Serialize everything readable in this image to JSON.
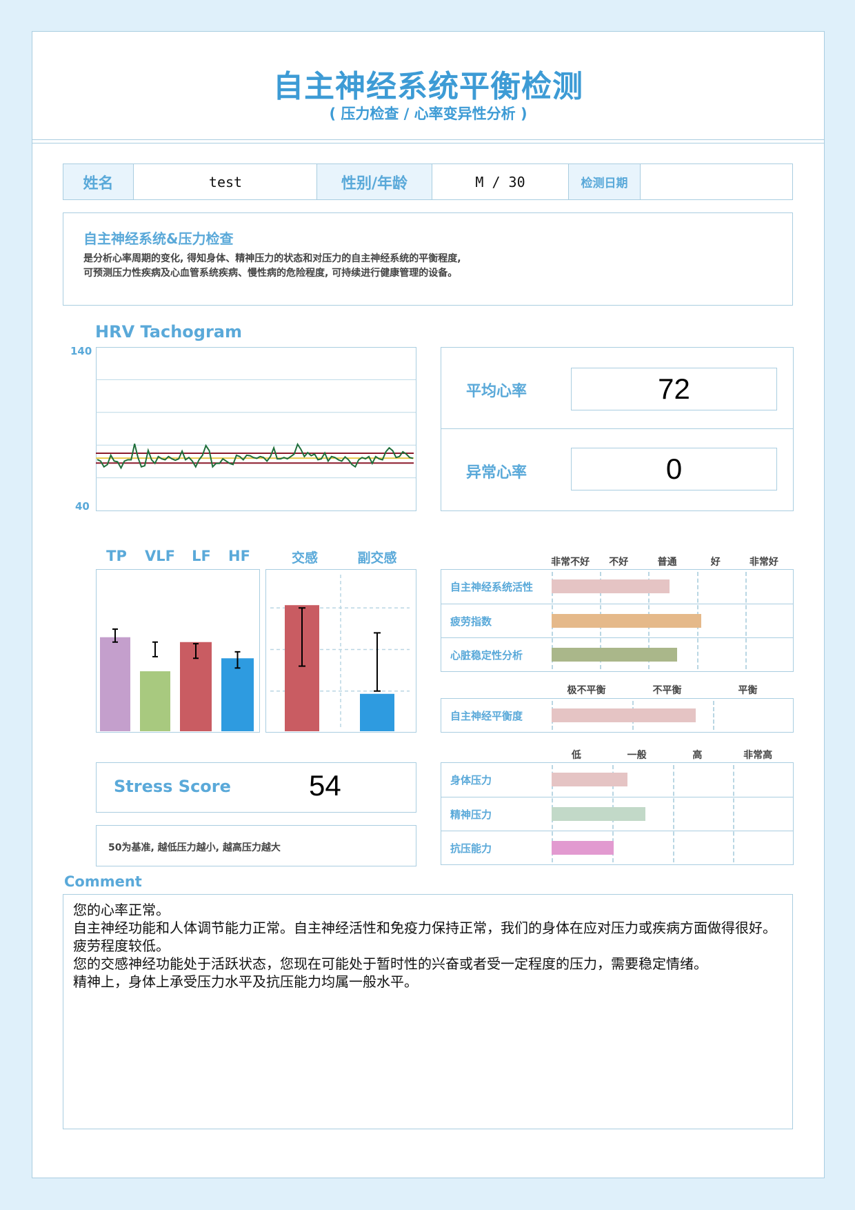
{
  "header": {
    "title": "自主神经系统平衡检测",
    "subtitle": "( 压力检查 / 心率变异性分析 )"
  },
  "info": {
    "name_label": "姓名",
    "name_value": "test",
    "sex_age_label": "性别/年龄",
    "sex_age_value": "M / 30",
    "date_label": "检测日期",
    "date_value": ""
  },
  "description": {
    "title": "自主神经系统&压力检查",
    "line1": "是分析心率周期的变化, 得知身体、精神压力的状态和对压力的自主神经系统的平衡程度,",
    "line2": "可预测压力性疾病及心血管系统疾病、慢性病的危险程度, 可持续进行健康管理的设备。"
  },
  "heart_rate": {
    "avg_label": "平均心率",
    "avg_value": "72",
    "abnormal_label": "异常心率",
    "abnormal_value": "0"
  },
  "stress_score": {
    "label": "Stress Score",
    "value": "54",
    "note": "50为基准, 越低压力越小, 越高压力越大"
  },
  "comment": {
    "heading": "Comment",
    "lines": [
      "您的心率正常。",
      "自主神经功能和人体调节能力正常。自主神经活性和免疫力保持正常，我们的身体在应对压力或疾病方面做得很好。",
      "疲劳程度较低。",
      "您的交感神经功能处于活跃状态，您现在可能处于暂时性的兴奋或者受一定程度的压力，需要稳定情绪。",
      "精神上，身体上承受压力水平及抗压能力均属一般水平。"
    ]
  },
  "colors": {
    "accent": "#5aa9d9",
    "title": "#3d9bd5",
    "border": "#a9cde0",
    "background": "#dff0fa"
  },
  "chart_data": [
    {
      "id": "tachogram",
      "type": "line",
      "title": "HRV Tachogram",
      "ylim": [
        40,
        140
      ],
      "ytick_labels": [
        "140",
        "40"
      ],
      "grid": true,
      "reference_lines": [
        {
          "name": "upper",
          "value": 75,
          "color": "#8b1a2b"
        },
        {
          "name": "mean",
          "value": 72,
          "color": "#e8c84a"
        },
        {
          "name": "lower",
          "value": 69,
          "color": "#8b1a2b"
        }
      ],
      "series": [
        {
          "name": "heart-rate",
          "color": "#1f6e3a",
          "values": [
            71.2,
            70.2,
            66.7,
            68.1,
            73.8,
            70.2,
            69.8,
            66,
            70.2,
            71,
            71,
            80.8,
            72.4,
            66.7,
            67.4,
            76.8,
            71,
            68.8,
            73,
            71.6,
            71,
            73,
            71.6,
            70.7,
            71.6,
            76.3,
            71,
            72.4,
            70.2,
            66.7,
            71,
            73.8,
            79.7,
            76.6,
            66.7,
            68.8,
            68.8,
            71.6,
            70.2,
            68.8,
            68.1,
            73.8,
            73,
            71,
            73.8,
            73.5,
            72.4,
            71.9,
            73,
            72.4,
            70.2,
            73,
            78.3,
            71.6,
            71.6,
            72.4,
            71.6,
            73,
            74.5,
            80.5,
            77.3,
            73,
            75.4,
            73.5,
            74.5,
            71,
            71.6,
            75.2,
            70.2,
            73,
            72.4,
            71,
            70.2,
            72.8,
            71,
            68.1,
            66.7,
            71,
            72.4,
            71.6,
            73,
            68.8,
            73,
            71.6,
            71,
            75.9,
            78.3,
            76.6,
            72.4,
            73,
            75.9,
            74.5,
            72.4,
            71.9
          ]
        }
      ]
    },
    {
      "id": "spectrum",
      "type": "bar",
      "categories": [
        "TP",
        "VLF",
        "LF",
        "HF"
      ],
      "ylim": [
        0,
        100
      ],
      "values": [
        58,
        37,
        55,
        45
      ],
      "error_ranges": [
        [
          55,
          63
        ],
        [
          46,
          55
        ],
        [
          45,
          54
        ],
        [
          39,
          49
        ]
      ],
      "colors": [
        "#c49fcc",
        "#a8c97f",
        "#c95c62",
        "#2e9be0"
      ]
    },
    {
      "id": "ans-balance",
      "type": "bar",
      "categories": [
        "交感",
        "副交感"
      ],
      "ylim": [
        0,
        118
      ],
      "gridlines": [
        30,
        60,
        90
      ],
      "values": [
        92,
        28
      ],
      "error_ranges": [
        [
          48,
          90
        ],
        [
          30,
          72
        ]
      ],
      "colors": [
        "#c95c62",
        "#2e9be0"
      ]
    },
    {
      "id": "ans-indicators",
      "type": "bar",
      "orientation": "horizontal",
      "scale_labels": [
        "非常不好",
        "不好",
        "普通",
        "好",
        "非常好"
      ],
      "rows": [
        {
          "label": "自主神经系统活性",
          "value": 0.486,
          "color": "#e5c4c4"
        },
        {
          "label": "疲劳指数",
          "value": 0.617,
          "color": "#e5b98a"
        },
        {
          "label": "心脏稳定性分析",
          "value": 0.517,
          "color": "#aab78a"
        }
      ]
    },
    {
      "id": "balance-degree",
      "type": "bar",
      "orientation": "horizontal",
      "scale_labels": [
        "极不平衡",
        "不平衡",
        "平衡"
      ],
      "rows": [
        {
          "label": "自主神经平衡度",
          "value": 0.595,
          "color": "#e5c4c4"
        }
      ]
    },
    {
      "id": "stress-levels",
      "type": "bar",
      "orientation": "horizontal",
      "scale_labels": [
        "低",
        "一般",
        "高",
        "非常高"
      ],
      "rows": [
        {
          "label": "身体压力",
          "value": 0.313,
          "color": "#e5c4c4"
        },
        {
          "label": "精神压力",
          "value": 0.387,
          "color": "#c2d9c8"
        },
        {
          "label": "抗压能力",
          "value": 0.256,
          "color": "#e29ad0"
        }
      ]
    }
  ]
}
